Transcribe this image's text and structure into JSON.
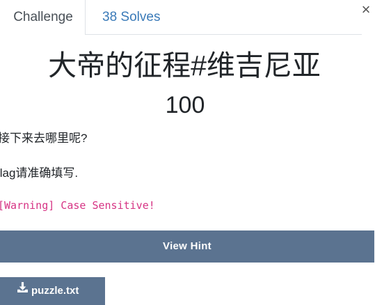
{
  "tabs": {
    "challenge_label": "Challenge",
    "solves_label": "38 Solves"
  },
  "close_glyph": "×",
  "challenge": {
    "title": "大帝的征程#维吉尼亚",
    "value": "100",
    "description_line1": "接下来去哪里呢?",
    "description_line2": "flag请准确填写.",
    "warning": "[Warning] Case Sensitive!"
  },
  "buttons": {
    "hint_label": "View Hint",
    "file_label": "puzzle.txt",
    "file_icon": "download-icon"
  },
  "colors": {
    "accent": "#5b7390",
    "link": "#3a7ab8",
    "warning": "#d63384"
  }
}
